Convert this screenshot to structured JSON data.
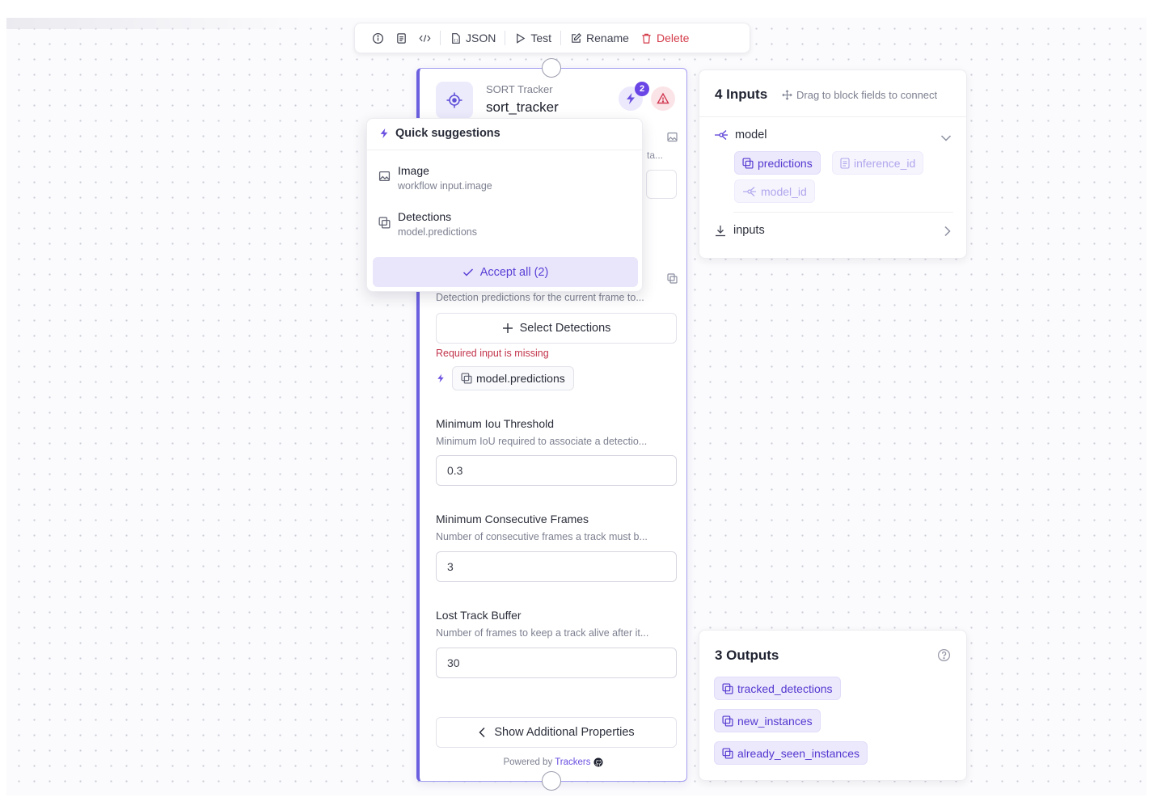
{
  "toolbar": {
    "json_label": "JSON",
    "test_label": "Test",
    "rename_label": "Rename",
    "delete_label": "Delete"
  },
  "node": {
    "subtitle": "SORT Tracker",
    "title": "sort_tracker",
    "suggestion_count": "2",
    "hidden_desc_fragment": "ta...",
    "detections_desc": "Detection predictions for the current frame to...",
    "select_detections_label": "Select Detections",
    "required_missing": "Required input is missing",
    "suggested_source": "model.predictions",
    "fields": [
      {
        "label": "Minimum Iou Threshold",
        "desc": "Minimum IoU required to associate a detectio...",
        "value": "0.3"
      },
      {
        "label": "Minimum Consecutive Frames",
        "desc": "Number of consecutive frames a track must b...",
        "value": "3"
      },
      {
        "label": "Lost Track Buffer",
        "desc": "Number of frames to keep a track alive after it...",
        "value": "30"
      }
    ],
    "show_more_label": "Show Additional Properties",
    "powered_by": "Powered by",
    "powered_brand": "Trackers"
  },
  "quick_suggestions": {
    "title": "Quick suggestions",
    "items": [
      {
        "title": "Image",
        "subtitle": "workflow input.image",
        "icon": "image-icon"
      },
      {
        "title": "Detections",
        "subtitle": "model.predictions",
        "icon": "detections-icon"
      }
    ],
    "accept_label": "Accept all (2)"
  },
  "inputs_panel": {
    "title": "4 Inputs",
    "hint": "Drag to block fields to connect",
    "groups": [
      {
        "name": "model",
        "expanded": true,
        "chips": [
          "predictions",
          "inference_id",
          "model_id"
        ]
      },
      {
        "name": "inputs",
        "expanded": false
      }
    ]
  },
  "outputs_panel": {
    "title": "3 Outputs",
    "items": [
      "tracked_detections",
      "new_instances",
      "already_seen_instances"
    ]
  },
  "colors": {
    "accent": "#6b4fe0",
    "node_border": "#6b5fe0",
    "danger": "#d43c4a"
  }
}
